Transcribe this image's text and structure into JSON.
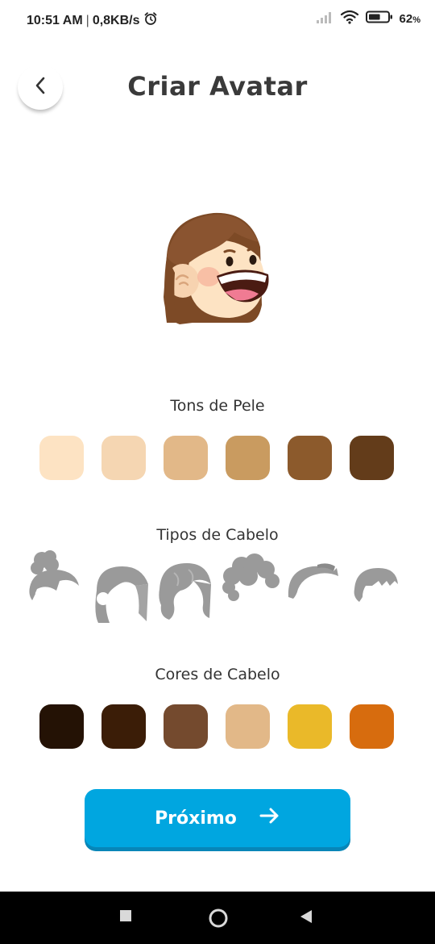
{
  "status_bar": {
    "time": "10:51 AM",
    "separator": "|",
    "speed": "0,8KB/s",
    "battery": "62",
    "battery_unit": "%",
    "battery_level": 0.62,
    "icons": [
      "alarm-icon",
      "signal-icon",
      "wifi-icon",
      "battery-icon"
    ]
  },
  "header": {
    "title": "Criar Avatar",
    "back_icon": "chevron-left-icon"
  },
  "skin_tones": {
    "title": "Tons de Pele",
    "colors": [
      "#fde3c3",
      "#f5d6b2",
      "#e2b888",
      "#c99b60",
      "#8c5a2c",
      "#633c1a"
    ]
  },
  "hair_types": {
    "title": "Tipos de Cabelo",
    "icons": [
      "hair-bun-icon",
      "hair-long-straight-icon",
      "hair-long-wavy-icon",
      "hair-curly-icon",
      "hair-short-swept-icon",
      "hair-bob-bangs-icon"
    ]
  },
  "hair_colors": {
    "title": "Cores de Cabelo",
    "colors": [
      "#241205",
      "#3b1d07",
      "#744a2e",
      "#e2b888",
      "#eab929",
      "#d76c0e"
    ]
  },
  "next_button": {
    "label": "Próximo",
    "icon": "arrow-right-icon"
  },
  "nav_bar": {
    "icons": [
      "recents-square-icon",
      "home-circle-icon",
      "back-triangle-icon"
    ]
  }
}
